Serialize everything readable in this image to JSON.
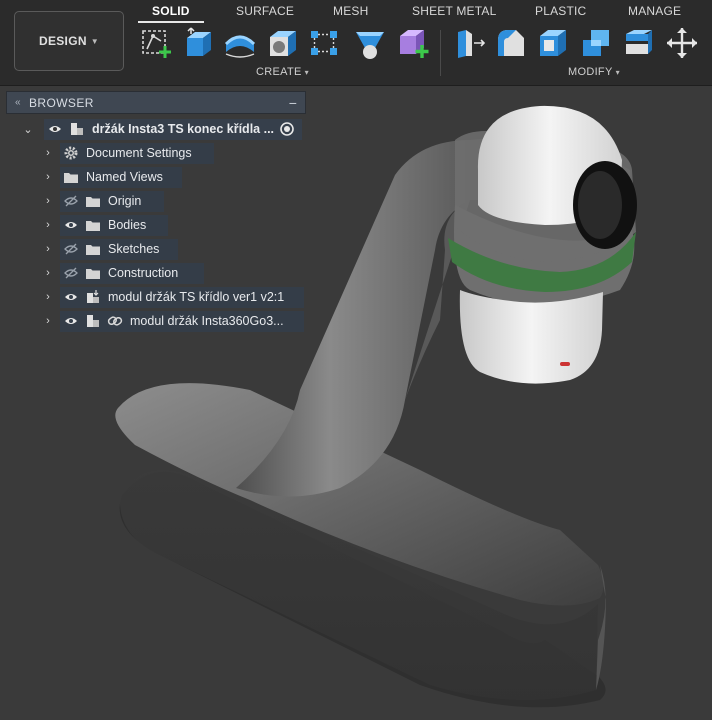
{
  "workspace": {
    "label": "DESIGN"
  },
  "tabs": [
    {
      "label": "SOLID",
      "active": true
    },
    {
      "label": "SURFACE"
    },
    {
      "label": "MESH"
    },
    {
      "label": "SHEET METAL"
    },
    {
      "label": "PLASTIC"
    },
    {
      "label": "MANAGE"
    }
  ],
  "groups": {
    "create": "CREATE",
    "modify": "MODIFY"
  },
  "create_tools": [
    "create-sketch-icon",
    "extrude-icon",
    "revolve-icon",
    "hole-icon",
    "rectangular-pattern-icon",
    "loft-icon",
    "new-component-icon"
  ],
  "modify_tools": [
    "press-pull-icon",
    "fillet-icon",
    "shell-icon",
    "combine-icon",
    "align-icon",
    "move-icon"
  ],
  "browser": {
    "title": "BROWSER",
    "root": {
      "label": "držák Insta3 TS konec křídla ..."
    },
    "items": [
      {
        "label": "Document Settings",
        "icon": "gear-icon"
      },
      {
        "label": "Named Views",
        "icon": "folder-icon"
      },
      {
        "label": "Origin",
        "icon": "folder-icon",
        "visibility": "hidden"
      },
      {
        "label": "Bodies",
        "icon": "folder-icon",
        "visibility": "visible"
      },
      {
        "label": "Sketches",
        "icon": "folder-icon",
        "visibility": "hidden"
      },
      {
        "label": "Construction",
        "icon": "folder-icon",
        "visibility": "hidden"
      },
      {
        "label": "modul držák TS křídlo ver1 v2:1",
        "icon": "component-icon",
        "visibility": "visible"
      },
      {
        "label": "modul držák Insta360Go3...",
        "icon": "component-icon",
        "visibility": "visible",
        "linked": true
      }
    ]
  },
  "colors": {
    "toolbar_bg": "#2b2b2b",
    "canvas_bg": "#3a3a3a",
    "accent_blue": "#3aa0e8",
    "accent_purple": "#a77ee0",
    "green_band": "#3f7a43"
  }
}
